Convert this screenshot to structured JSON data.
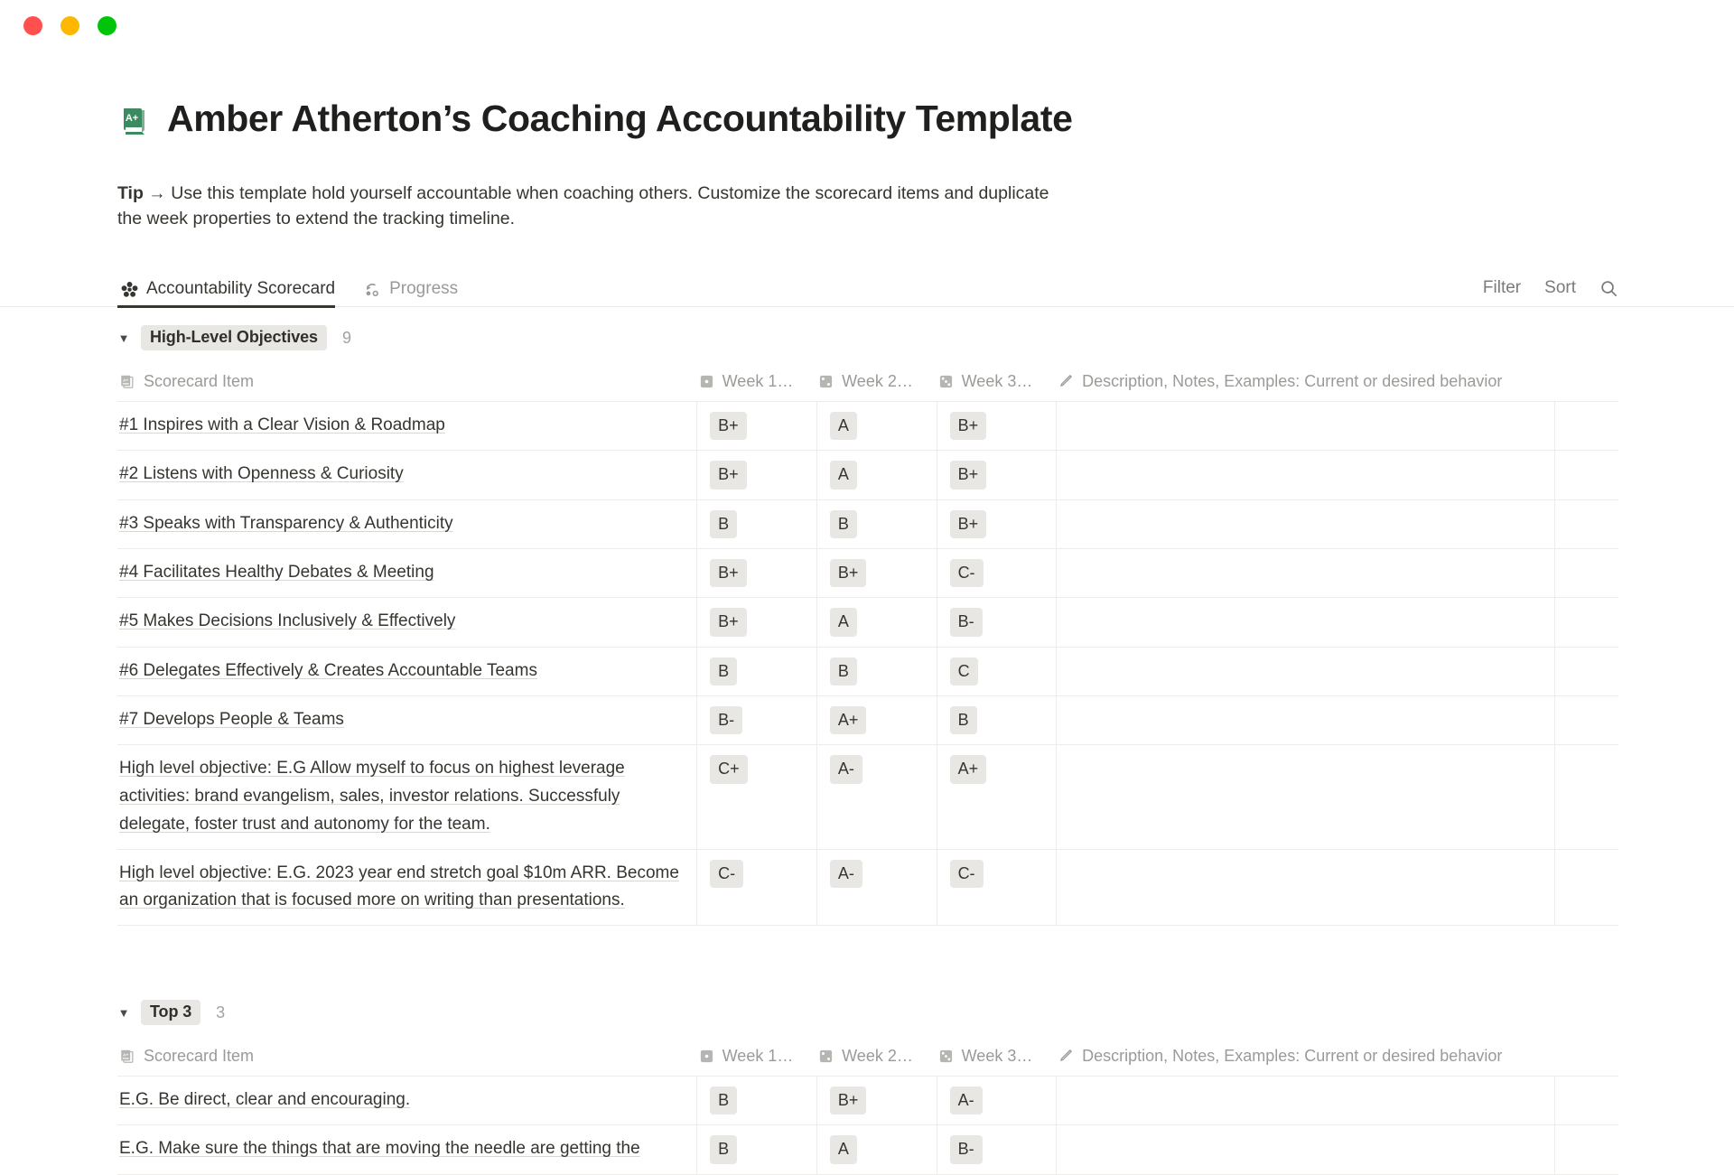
{
  "window": {
    "traffic_lights": [
      {
        "name": "close",
        "color": "#ff4f4f"
      },
      {
        "name": "minimize",
        "color": "#ffb700"
      },
      {
        "name": "maximize",
        "color": "#00c40a"
      }
    ]
  },
  "header": {
    "emoji_icon": "green-book-a-plus-icon",
    "title": "Amber Atherton’s Coaching Accountability Template",
    "tip_label": "Tip →",
    "tip_text": " Use this template hold yourself accountable when coaching others. Customize the scorecard items and duplicate the week properties to extend the tracking timeline."
  },
  "tabs": [
    {
      "label": "Accountability Scorecard",
      "icon": "table-grid-icon",
      "active": true
    },
    {
      "label": "Progress",
      "icon": "progress-chart-icon",
      "active": false
    }
  ],
  "toolbar": {
    "filter_label": "Filter",
    "sort_label": "Sort",
    "search_icon": "search-icon"
  },
  "columns": {
    "item": {
      "label": "Scorecard Item",
      "icon": "book-a-plus-icon"
    },
    "week1": {
      "label": "Week 1…",
      "icon": "dice-one-icon"
    },
    "week2": {
      "label": "Week 2…",
      "icon": "dice-two-icon"
    },
    "week3": {
      "label": "Week 3…",
      "icon": "dice-three-icon"
    },
    "description": {
      "label": "Description, Notes, Examples: Current or desired behavior",
      "icon": "pencil-icon"
    }
  },
  "groups": [
    {
      "name": "High-Level Objectives",
      "count": "9",
      "caret": "▼",
      "rows": [
        {
          "item": "#1 Inspires with a Clear Vision & Roadmap",
          "week1": "B+",
          "week2": "A",
          "week3": "B+",
          "description": ""
        },
        {
          "item": "#2 Listens with Openness & Curiosity",
          "week1": "B+",
          "week2": "A",
          "week3": "B+",
          "description": ""
        },
        {
          "item": "#3 Speaks with Transparency & Authenticity",
          "week1": "B",
          "week2": "B",
          "week3": "B+",
          "description": ""
        },
        {
          "item": "#4 Facilitates Healthy Debates & Meeting",
          "week1": "B+",
          "week2": "B+",
          "week3": "C-",
          "description": ""
        },
        {
          "item": "#5 Makes Decisions Inclusively & Effectively",
          "week1": "B+",
          "week2": "A",
          "week3": "B-",
          "description": ""
        },
        {
          "item": "#6 Delegates Effectively & Creates Accountable Teams",
          "week1": "B",
          "week2": "B",
          "week3": "C",
          "description": ""
        },
        {
          "item": "#7 Develops People & Teams",
          "week1": "B-",
          "week2": "A+",
          "week3": "B",
          "description": ""
        },
        {
          "item": "High level objective: E.G Allow myself to focus on highest leverage activities: brand evangelism, sales, investor relations. Successfuly delegate, foster trust and autonomy for the team.",
          "week1": "C+",
          "week2": "A-",
          "week3": "A+",
          "description": ""
        },
        {
          "item": "High level objective: E.G. 2023 year end stretch goal $10m ARR. Become an organization that is focused more on writing than presentations.",
          "week1": "C-",
          "week2": "A-",
          "week3": "C-",
          "description": ""
        }
      ]
    },
    {
      "name": "Top 3",
      "count": "3",
      "caret": "▼",
      "rows": [
        {
          "item": "E.G. Be direct, clear and encouraging.",
          "week1": "B",
          "week2": "B+",
          "week3": "A-",
          "description": ""
        },
        {
          "item": "E.G. Make sure the things that are moving the needle are getting the",
          "week1": "B",
          "week2": "A",
          "week3": "B-",
          "description": ""
        }
      ]
    }
  ]
}
